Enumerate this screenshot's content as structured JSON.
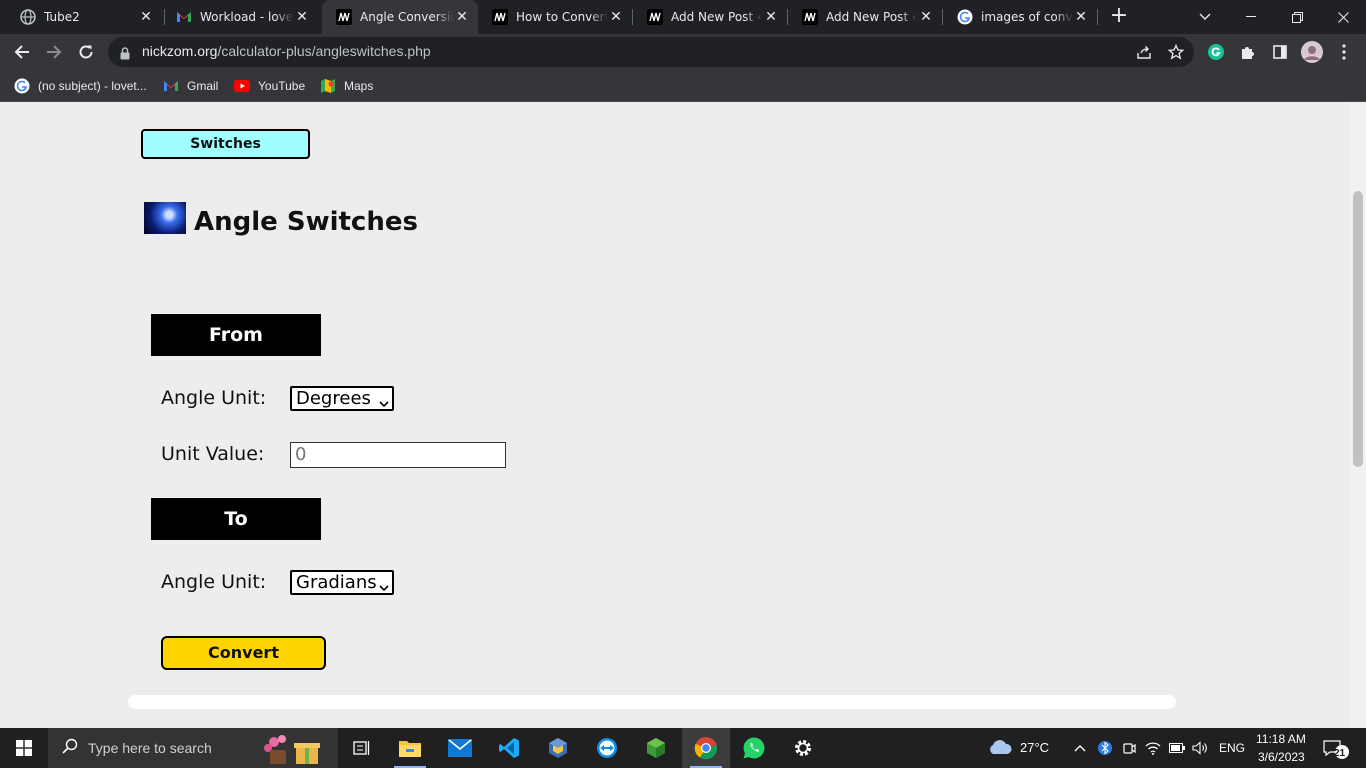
{
  "browser": {
    "tabs": [
      {
        "title": "Tube2",
        "icon": "globe-icon",
        "active": false
      },
      {
        "title": "Workload - lovet",
        "icon": "gmail-icon",
        "active": false
      },
      {
        "title": "Angle Conversion",
        "icon": "nickzom-icon",
        "active": true
      },
      {
        "title": "How to Convert",
        "icon": "nickzom-icon",
        "active": false
      },
      {
        "title": "Add New Post ‹ N",
        "icon": "nickzom-icon",
        "active": false
      },
      {
        "title": "Add New Post ‹ N",
        "icon": "nickzom-icon",
        "active": false
      },
      {
        "title": "images of conver",
        "icon": "google-icon",
        "active": false
      }
    ],
    "url_host": "nickzom.org",
    "url_path": "/calculator-plus/angleswitches.php",
    "bookmarks": [
      {
        "label": "(no subject) - lovet...",
        "icon": "google-icon"
      },
      {
        "label": "Gmail",
        "icon": "gmail-icon"
      },
      {
        "label": "YouTube",
        "icon": "youtube-icon"
      },
      {
        "label": "Maps",
        "icon": "maps-icon"
      }
    ]
  },
  "page": {
    "switches_button": "Switches",
    "title": "Angle Switches",
    "from_heading": "From",
    "to_heading": "To",
    "from_angle_label": "Angle Unit:",
    "from_angle_value": "Degrees",
    "unit_value_label": "Unit Value:",
    "unit_value": "0",
    "to_angle_label": "Angle Unit:",
    "to_angle_value": "Gradians",
    "convert_button": "Convert"
  },
  "taskbar": {
    "search_placeholder": "Type here to search",
    "weather": "27°C",
    "language": "ENG",
    "time": "11:18 AM",
    "date": "3/6/2023",
    "notification_count": "21"
  }
}
